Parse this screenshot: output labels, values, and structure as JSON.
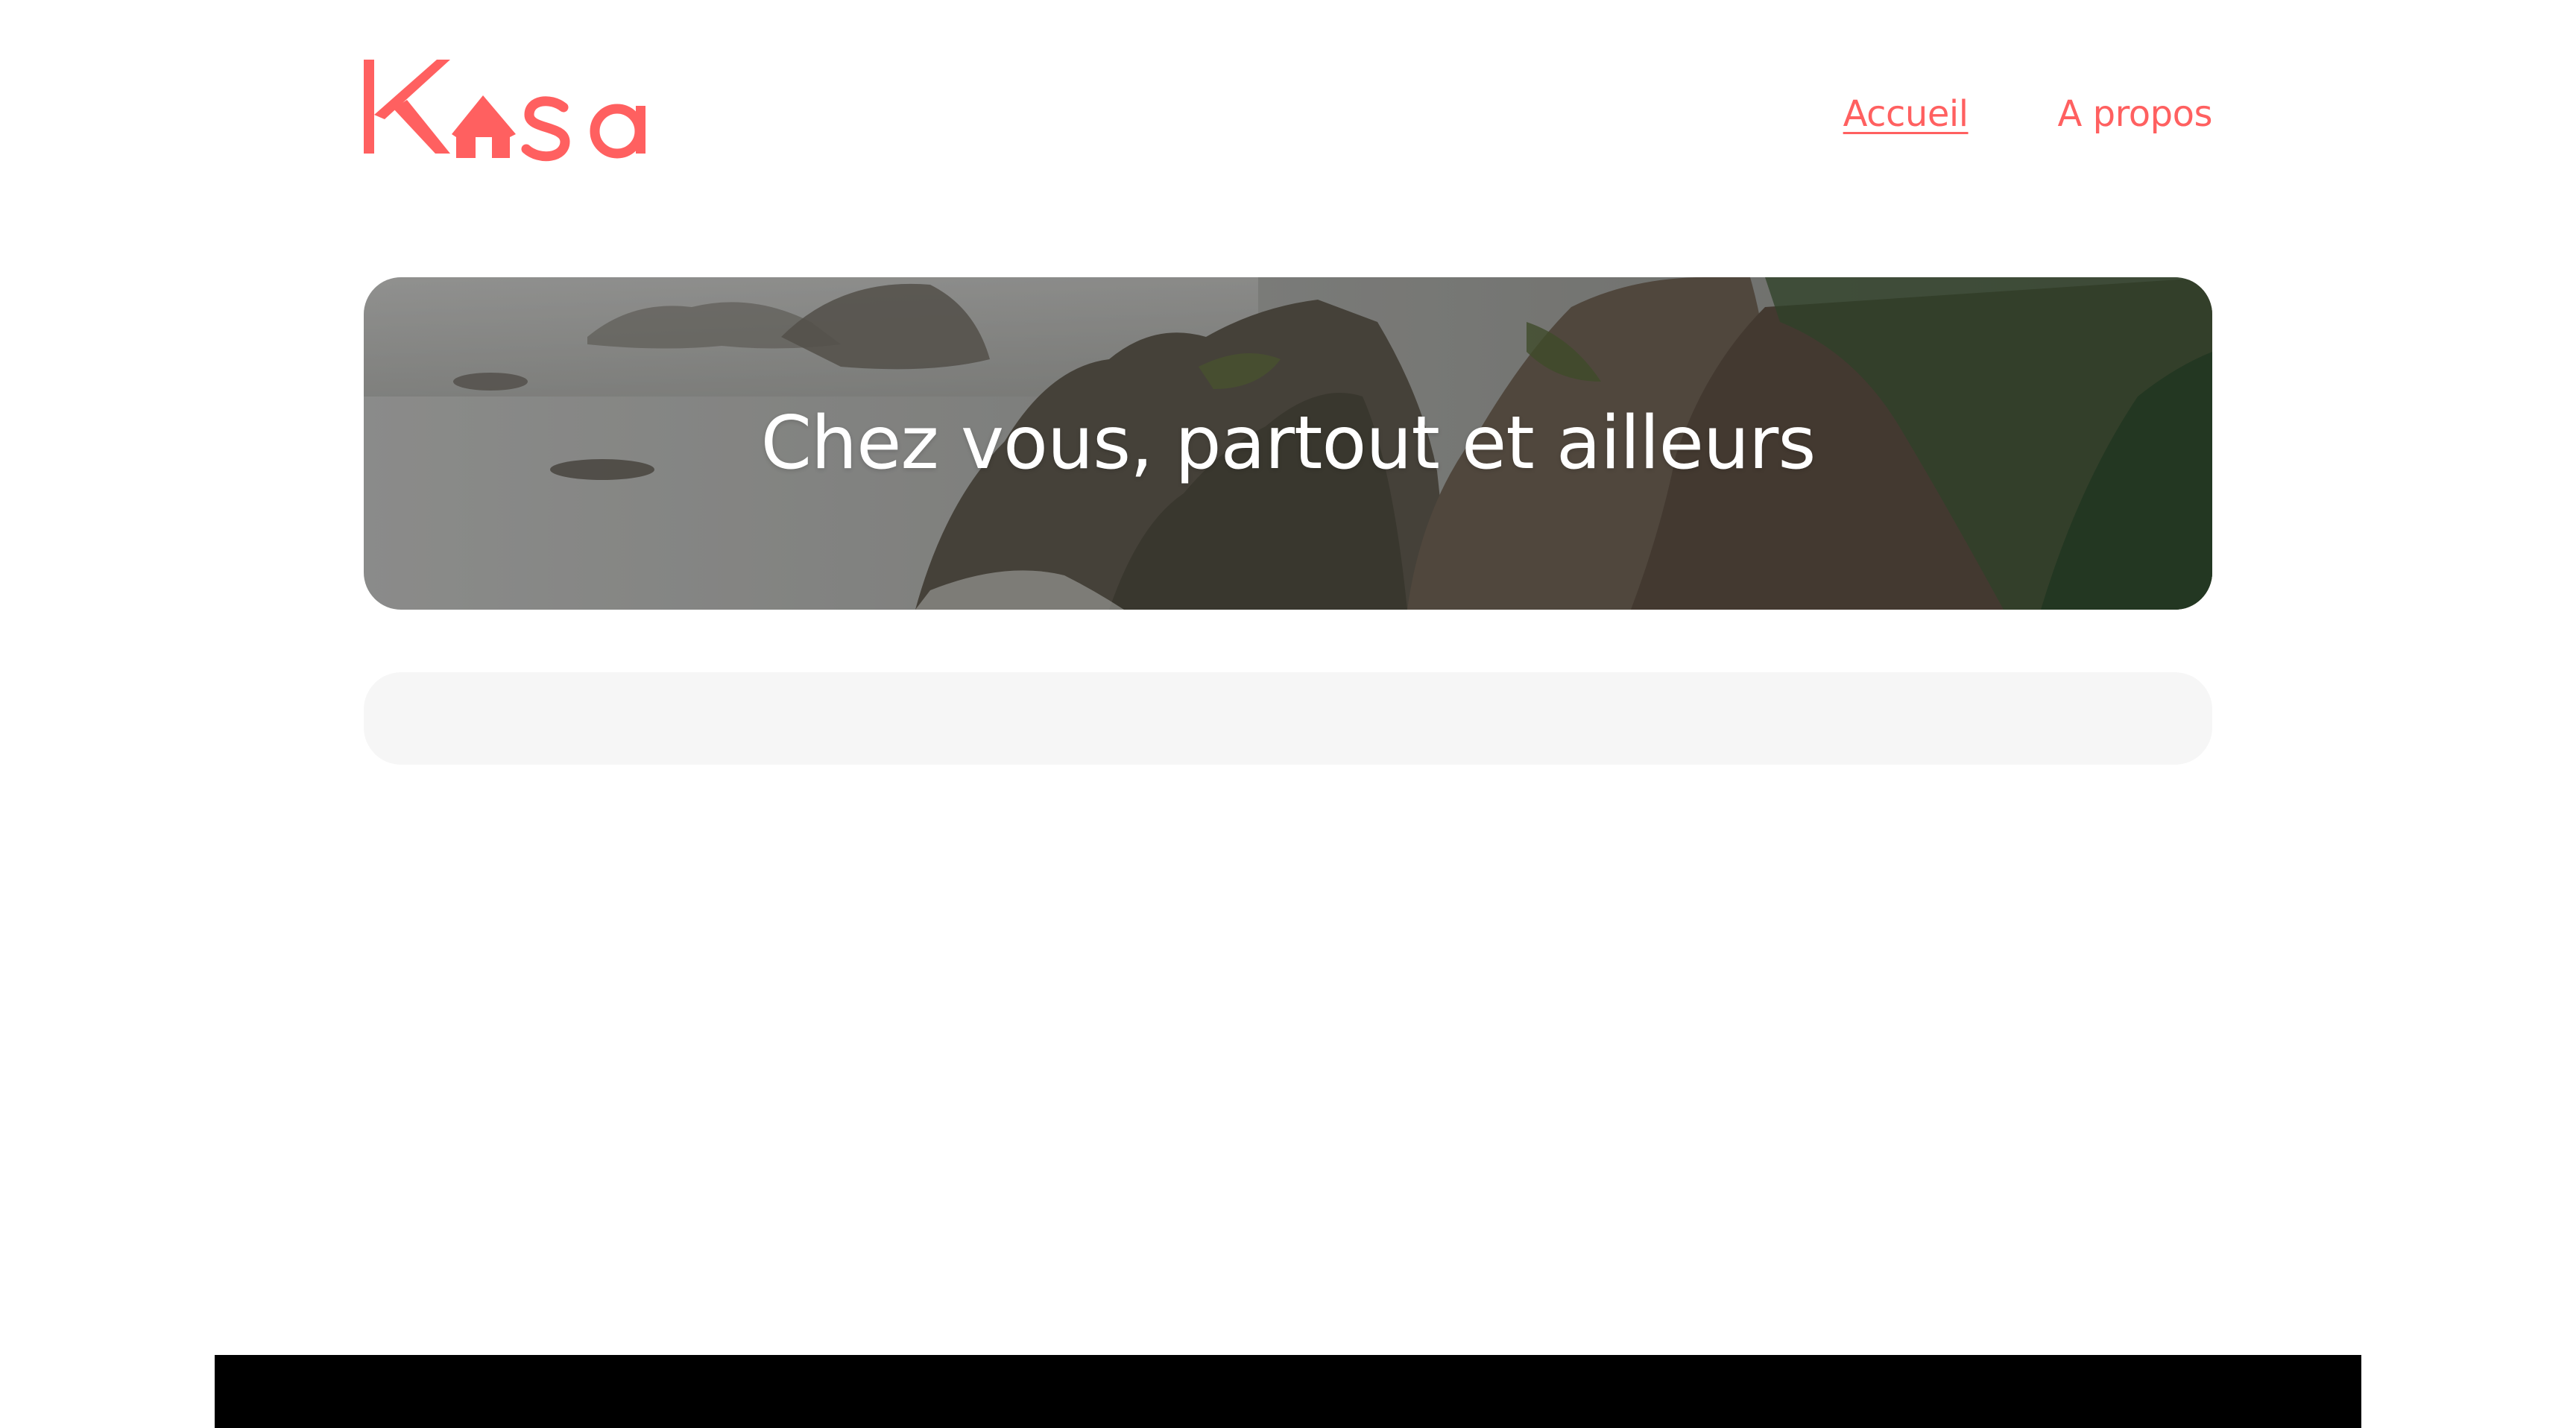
{
  "brand": {
    "name": "Kasa",
    "accent_color": "#FF6060"
  },
  "nav": {
    "items": [
      {
        "label": "Accueil",
        "active": true
      },
      {
        "label": "A propos",
        "active": false
      }
    ]
  },
  "banner": {
    "title": "Chez vous, partout et ailleurs",
    "image_icon": "coastal-cliffs-photo"
  },
  "colors": {
    "gallery_background": "#F6F6F6",
    "footer_background": "#000000",
    "page_background": "#FFFFFF"
  }
}
